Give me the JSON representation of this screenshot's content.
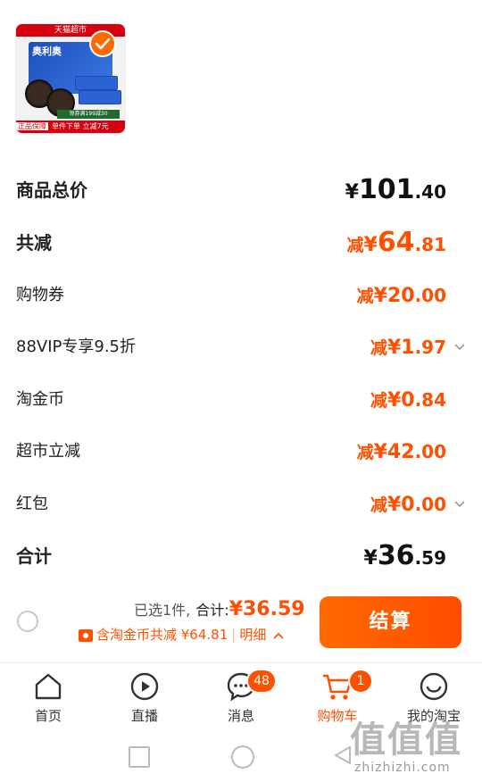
{
  "product": {
    "banner": "天猫超市",
    "brand": "奥利奥",
    "promo": "领券满199减30",
    "badge_guarantee": "正品保障",
    "footer_text": "单件下单 立减7元"
  },
  "summary": [
    {
      "label": "商品总价",
      "prefix": "",
      "currency": "¥",
      "int": "101",
      "dec": ".40",
      "style": "total"
    },
    {
      "label": "共减",
      "prefix": "减",
      "currency": "¥",
      "int": "64",
      "dec": ".81",
      "style": "discount-total"
    },
    {
      "label": "购物券",
      "prefix": "减",
      "currency": "¥",
      "int": "20",
      "dec": ".00",
      "style": "discount"
    },
    {
      "label": "88VIP专享9.5折",
      "prefix": "减",
      "currency": "¥",
      "int": "1",
      "dec": ".97",
      "style": "discount",
      "expandable": true
    },
    {
      "label": "淘金币",
      "prefix": "减",
      "currency": "¥",
      "int": "0",
      "dec": ".84",
      "style": "discount"
    },
    {
      "label": "超市立减",
      "prefix": "减",
      "currency": "¥",
      "int": "42",
      "dec": ".00",
      "style": "discount"
    },
    {
      "label": "红包",
      "prefix": "减",
      "currency": "¥",
      "int": "0",
      "dec": ".00",
      "style": "discount",
      "expandable": true
    },
    {
      "label": "合计",
      "prefix": "",
      "currency": "¥",
      "int": "36",
      "dec": ".59",
      "style": "total"
    }
  ],
  "checkout": {
    "selected": "已选1件,",
    "total_label": "合计:",
    "total_value": "¥36.59",
    "coin_note": "含淘金币共减 ¥64.81",
    "separator": "|",
    "detail": "明细",
    "pay_button": "结算"
  },
  "tabs": [
    {
      "label": "首页",
      "icon": "home-icon"
    },
    {
      "label": "直播",
      "icon": "live-icon"
    },
    {
      "label": "消息",
      "icon": "message-icon",
      "badge": "48"
    },
    {
      "label": "购物车",
      "icon": "cart-icon",
      "badge": "1",
      "active": true
    },
    {
      "label": "我的淘宝",
      "icon": "profile-icon"
    }
  ],
  "watermark": {
    "mark": "值值值",
    "url": "zhizhizhi.com"
  },
  "colors": {
    "accent": "#ff5000",
    "text": "#111111",
    "muted": "#555555"
  }
}
